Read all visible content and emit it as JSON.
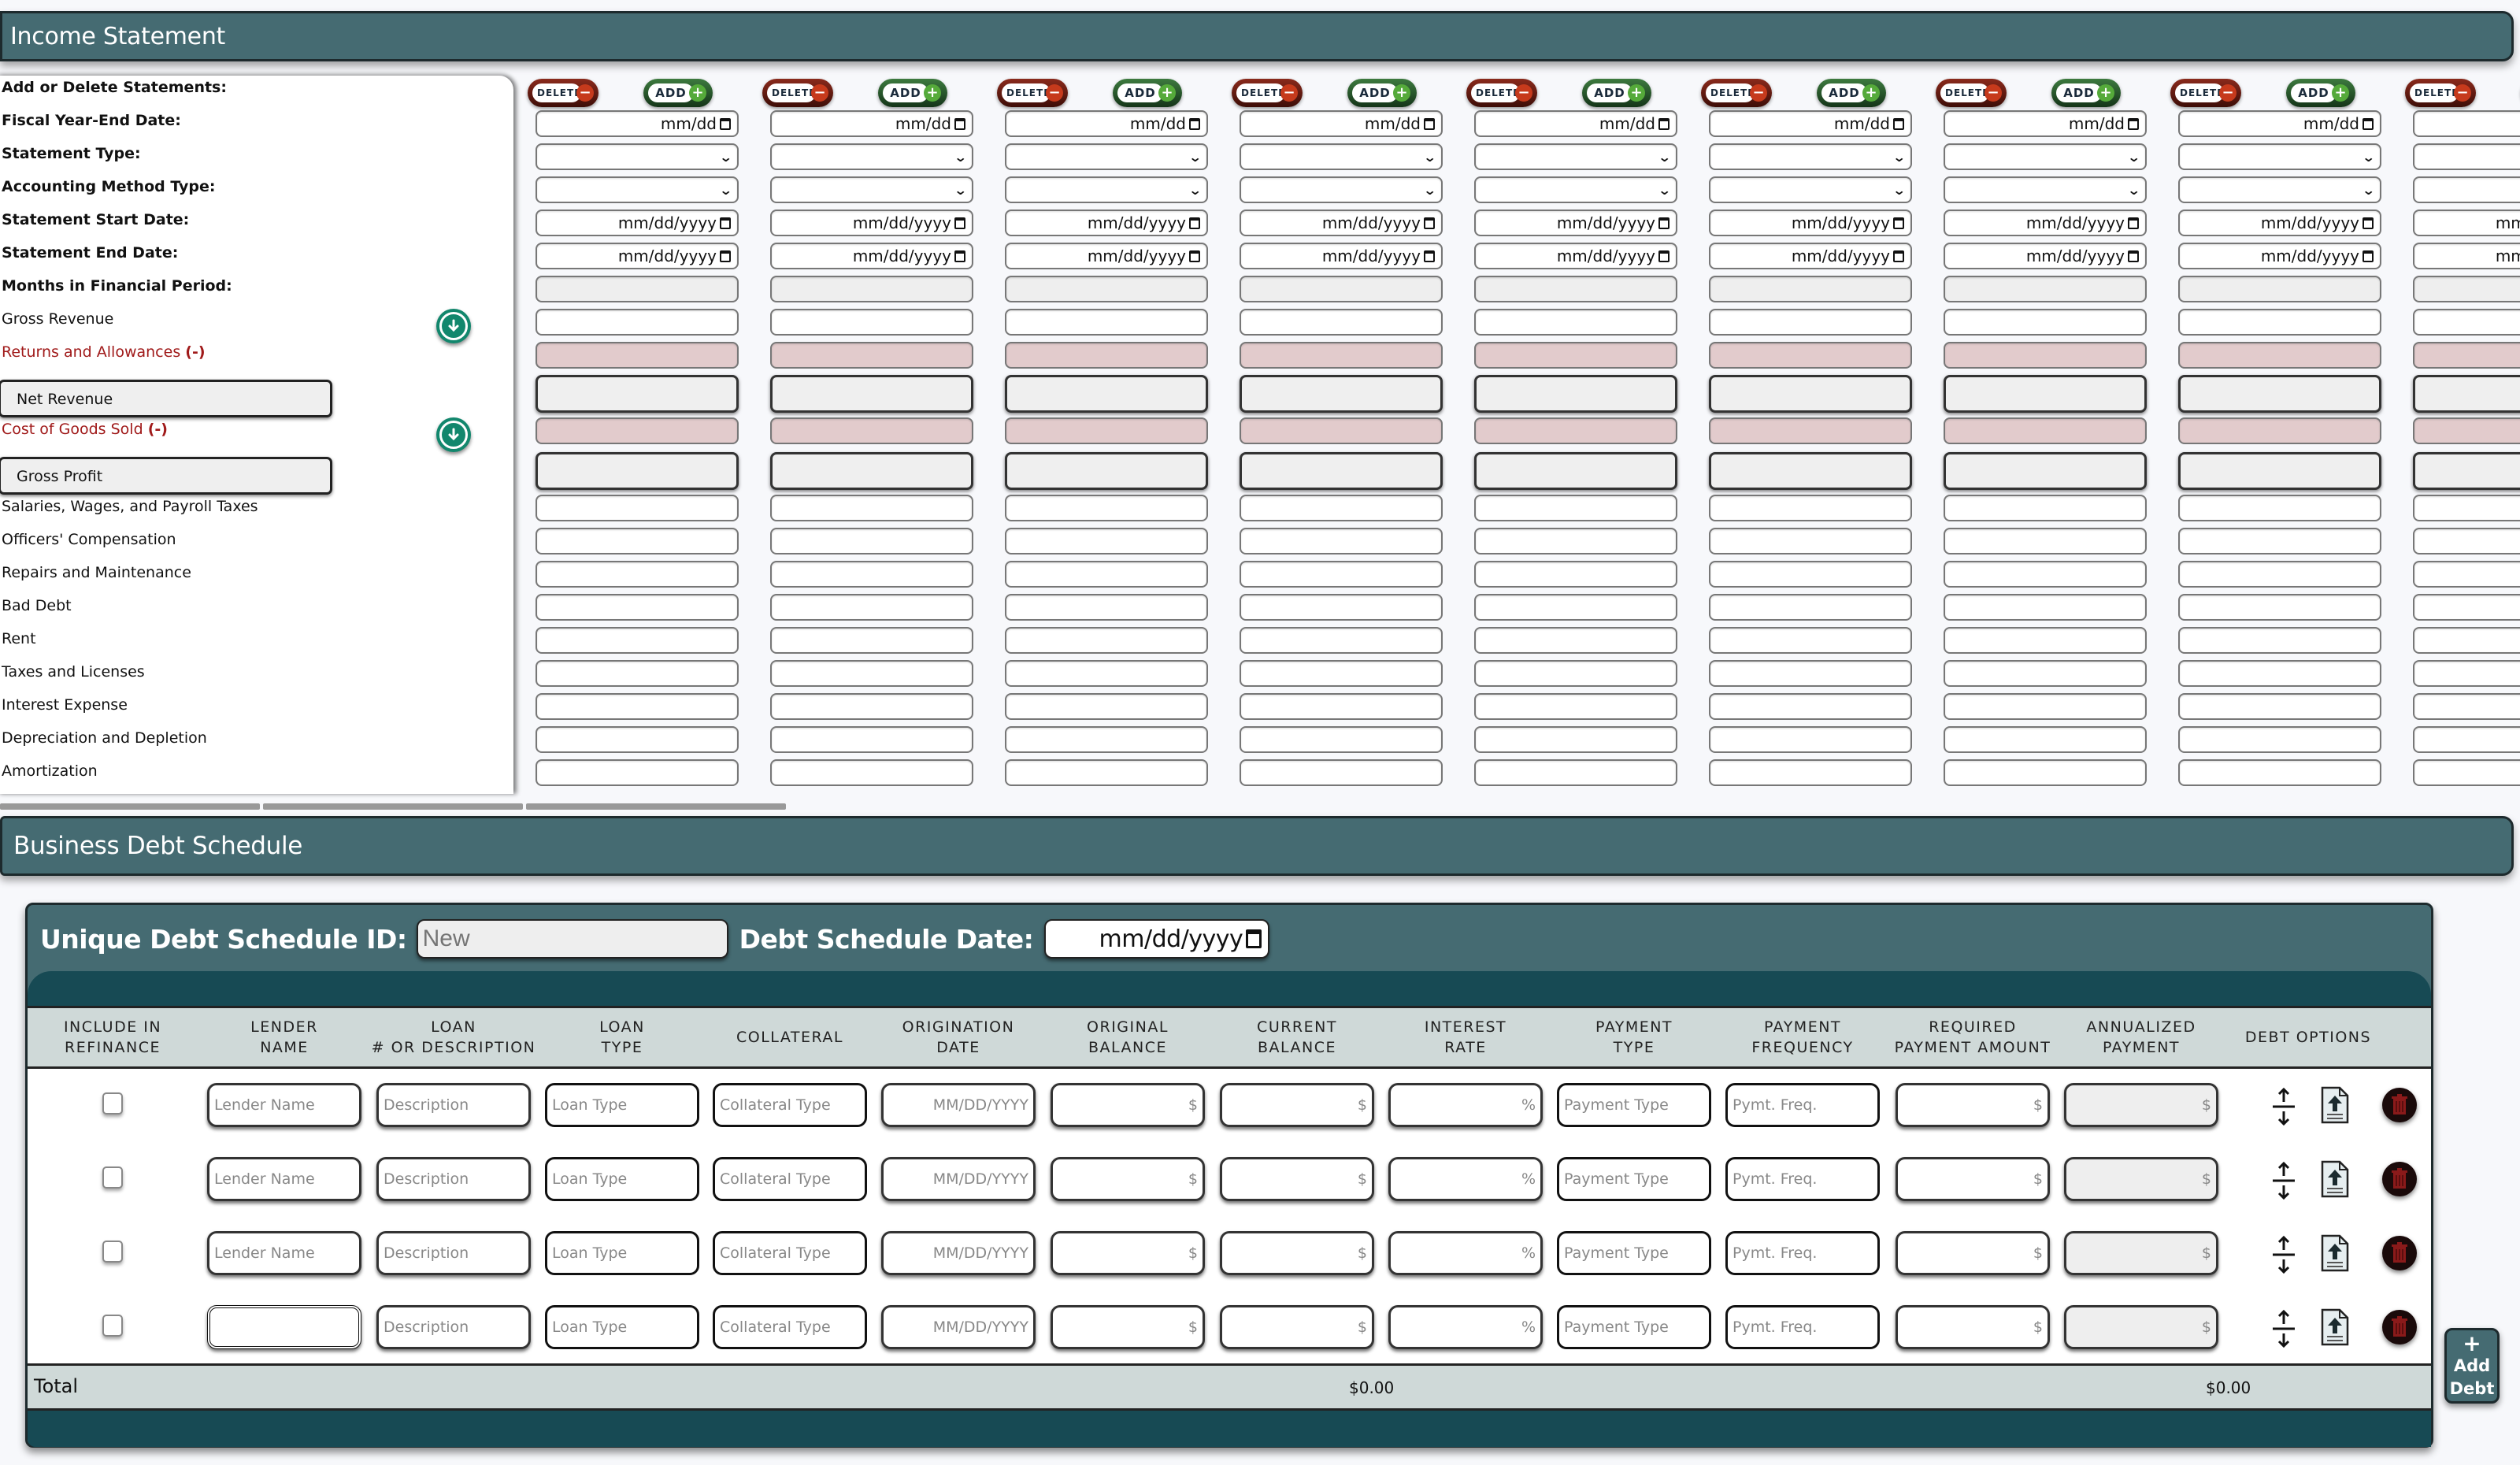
{
  "income_statement": {
    "title": "Income Statement",
    "labels": {
      "add_delete": "Add or Delete Statements:",
      "fiscal_year_end": "Fiscal Year-End Date:",
      "statement_type": "Statement Type:",
      "accounting_method": "Accounting Method Type:",
      "statement_start": "Statement Start Date:",
      "statement_end": "Statement End Date:",
      "months_in_period": "Months in Financial Period:",
      "gross_revenue": "Gross Revenue",
      "returns_allowances": "Returns and Allowances",
      "net_revenue": "Net Revenue",
      "cogs": "Cost of Goods Sold",
      "gross_profit": "Gross Profit",
      "salaries": "Salaries, Wages, and Payroll Taxes",
      "officers_comp": "Officers' Compensation",
      "repairs": "Repairs and Maintenance",
      "bad_debt": "Bad Debt",
      "rent": "Rent",
      "taxes_licenses": "Taxes and Licenses",
      "interest_expense": "Interest Expense",
      "depreciation": "Depreciation and Depletion",
      "amortization": "Amortization"
    },
    "minus_marker": "(-)",
    "delete_label": "DELETE",
    "add_label": "ADD",
    "plus_glyph": "+",
    "minus_glyph": "−",
    "fiscal_placeholder": "mm/dd",
    "date_placeholder": "mm/dd/yyyy",
    "column_count": 9,
    "accent_green": "#12876d",
    "negative_color": "#a01a1a"
  },
  "debt_schedule": {
    "title": "Business Debt Schedule",
    "id_label": "Unique Debt Schedule ID:",
    "id_placeholder": "New",
    "date_label": "Debt Schedule Date:",
    "date_placeholder": "mm/dd/yyyy",
    "columns": [
      {
        "l1": "INCLUDE IN",
        "l2": "REFINANCE"
      },
      {
        "l1": "LENDER",
        "l2": "NAME"
      },
      {
        "l1": "LOAN",
        "l2": "# OR DESCRIPTION"
      },
      {
        "l1": "LOAN",
        "l2": "TYPE"
      },
      {
        "l1": "COLLATERAL",
        "l2": ""
      },
      {
        "l1": "ORIGINATION",
        "l2": "DATE"
      },
      {
        "l1": "ORIGINAL",
        "l2": "BALANCE"
      },
      {
        "l1": "CURRENT",
        "l2": "BALANCE"
      },
      {
        "l1": "INTEREST",
        "l2": "RATE"
      },
      {
        "l1": "PAYMENT",
        "l2": "TYPE"
      },
      {
        "l1": "PAYMENT",
        "l2": "FREQUENCY"
      },
      {
        "l1": "REQUIRED",
        "l2": "PAYMENT AMOUNT"
      },
      {
        "l1": "ANNUALIZED",
        "l2": "PAYMENT"
      },
      {
        "l1": "DEBT OPTIONS",
        "l2": ""
      }
    ],
    "placeholders": {
      "lender": "Lender Name",
      "description": "Description",
      "loan_type": "Loan Type",
      "collateral": "Collateral Type",
      "origination": "MM/DD/YYYY",
      "currency": "$",
      "percent": "%",
      "payment_type": "Payment Type",
      "payment_freq": "Pymt. Freq."
    },
    "rows": [
      {
        "lender": "",
        "focused": false
      },
      {
        "lender": "",
        "focused": false
      },
      {
        "lender": "",
        "focused": false
      },
      {
        "lender": "",
        "focused": true
      }
    ],
    "total_label": "Total",
    "total_current_balance": "$0.00",
    "total_annualized_payment": "$0.00",
    "add_debt_plus": "+",
    "add_debt_l1": "Add",
    "add_debt_l2": "Debt",
    "header_color": "#456b72",
    "dark_color": "#174a54"
  }
}
